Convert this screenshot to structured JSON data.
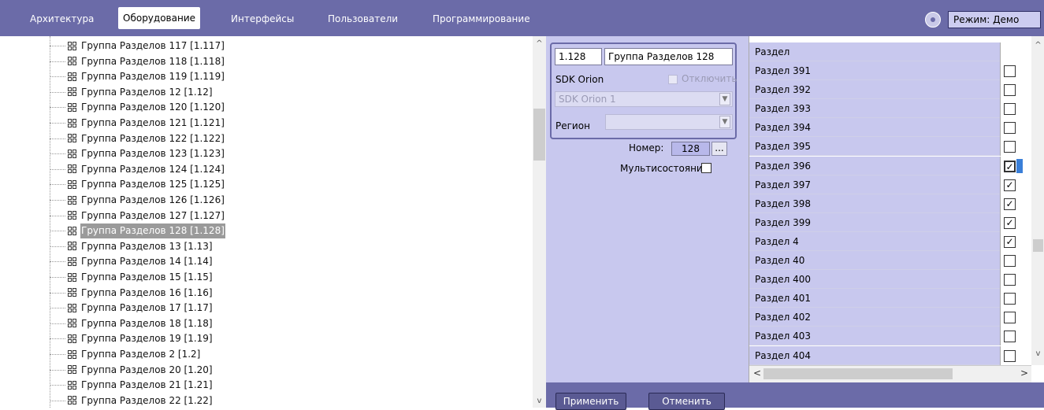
{
  "tabs": [
    {
      "label": "Архитектура",
      "active": false
    },
    {
      "label": "Оборудование",
      "active": true
    },
    {
      "label": "Интерфейсы",
      "active": false
    },
    {
      "label": "Пользователи",
      "active": false
    },
    {
      "label": "Программирование",
      "active": false
    }
  ],
  "mode": {
    "text": "Режим: Демо",
    "icon": "gear-icon"
  },
  "tree": {
    "items": [
      "Группа Разделов 117 [1.117]",
      "Группа Разделов 118 [1.118]",
      "Группа Разделов 119 [1.119]",
      "Группа Разделов 12 [1.12]",
      "Группа Разделов 120 [1.120]",
      "Группа Разделов 121 [1.121]",
      "Группа Разделов 122 [1.122]",
      "Группа Разделов 123 [1.123]",
      "Группа Разделов 124 [1.124]",
      "Группа Разделов 125 [1.125]",
      "Группа Разделов 126 [1.126]",
      "Группа Разделов 127 [1.127]",
      "Группа Разделов 128 [1.128]",
      "Группа Разделов 13 [1.13]",
      "Группа Разделов 14 [1.14]",
      "Группа Разделов 15 [1.15]",
      "Группа Разделов 16 [1.16]",
      "Группа Разделов 17 [1.17]",
      "Группа Разделов 18 [1.18]",
      "Группа Разделов 19 [1.19]",
      "Группа Разделов 2 [1.2]",
      "Группа Разделов 20 [1.20]",
      "Группа Разделов 21 [1.21]",
      "Группа Разделов 22 [1.22]"
    ],
    "selected_index": 12
  },
  "settings": {
    "id": "1.128",
    "name": "Группа Разделов 128",
    "sdk_label": "SDK Orion",
    "disable_label": "Отключить",
    "sdk_value": "SDK Orion 1",
    "region_label": "Регион",
    "region_value": "",
    "number_label": "Номер:",
    "number_value": "128",
    "dots": "...",
    "multistate_label": "Мультисостояния",
    "multistate_checked": false
  },
  "buttons": {
    "apply": "Применить",
    "cancel": "Отменить"
  },
  "table": {
    "header": "Раздел",
    "rows": [
      {
        "name": "Раздел 391",
        "checked": false
      },
      {
        "name": "Раздел 392",
        "checked": false
      },
      {
        "name": "Раздел 393",
        "checked": false
      },
      {
        "name": "Раздел 394",
        "checked": false
      },
      {
        "name": "Раздел 395",
        "checked": false
      },
      {
        "name": "Раздел 396",
        "checked": true
      },
      {
        "name": "Раздел 397",
        "checked": true
      },
      {
        "name": "Раздел 398",
        "checked": true
      },
      {
        "name": "Раздел 399",
        "checked": true
      },
      {
        "name": "Раздел 4",
        "checked": true
      },
      {
        "name": "Раздел 40",
        "checked": false
      },
      {
        "name": "Раздел 400",
        "checked": false
      },
      {
        "name": "Раздел 401",
        "checked": false
      },
      {
        "name": "Раздел 402",
        "checked": false
      },
      {
        "name": "Раздел 403",
        "checked": false
      },
      {
        "name": "Раздел 404",
        "checked": false
      }
    ],
    "focused_index": 5
  },
  "colors": {
    "accent": "#6b6ba8",
    "panel": "#c8c8ee",
    "selection": "#9a9a9a"
  }
}
